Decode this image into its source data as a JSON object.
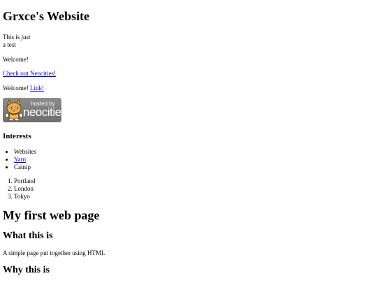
{
  "site_title": "Grxce's Website",
  "intro": {
    "line1_prefix": "This is ",
    "line1_em": "just",
    "line2": "a test"
  },
  "welcome_text": "Welcome!",
  "neocities_link": "Check out Neocities!",
  "welcome2_text": "Welcome! ",
  "welcome2_link": "Link!",
  "badge": {
    "small_text": "hosted by",
    "big_text": "neocities"
  },
  "interests": {
    "heading": "Interests",
    "items": [
      {
        "label": "Websites",
        "link": false
      },
      {
        "label": "Yarn",
        "link": true
      },
      {
        "label": "Catnip",
        "link": false
      }
    ]
  },
  "cities": [
    "Portland",
    "London",
    "Tokyo"
  ],
  "first_page_heading": "My first web page",
  "what_heading": "What this is",
  "what_desc": "A simple page put together using HTML",
  "why_heading": "Why this is"
}
